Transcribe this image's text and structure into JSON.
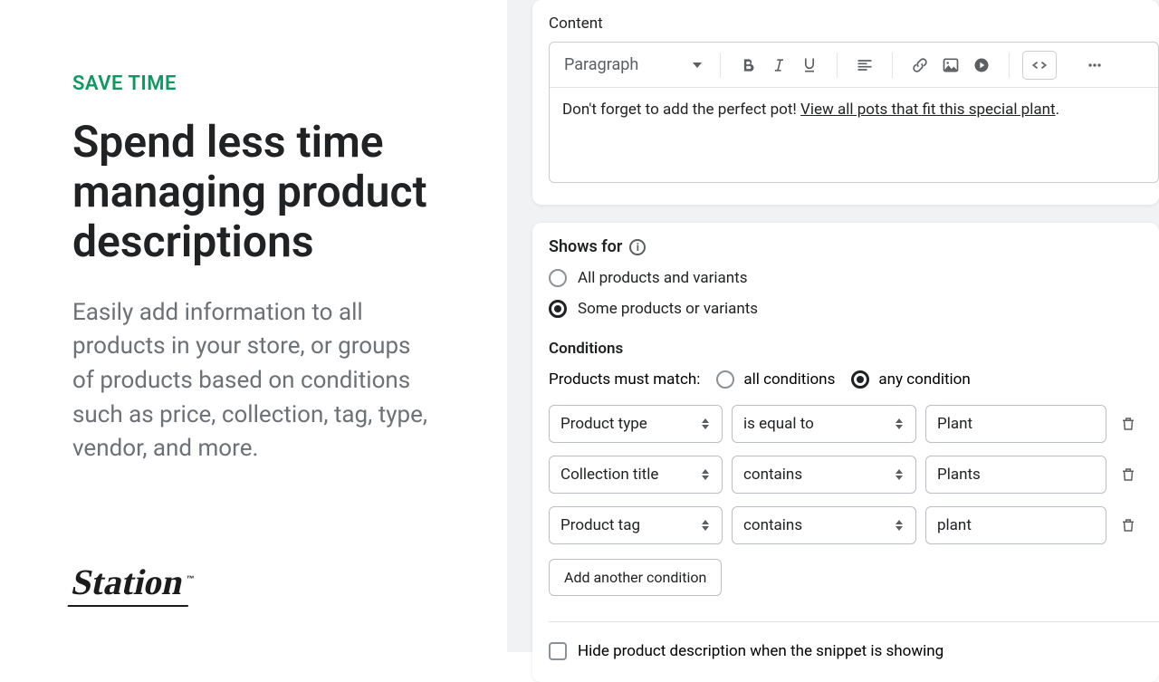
{
  "left": {
    "eyebrow": "SAVE TIME",
    "headline": "Spend less time managing product descriptions",
    "subhead": "Easily add information to all products in your store, or groups of products based on conditions such as price, collection, tag, type, vendor, and more.",
    "logo": "Station"
  },
  "editor": {
    "label": "Content",
    "paragraph_label": "Paragraph",
    "body_text_pre": "Don't forget to add the perfect pot! ",
    "body_link": "View all pots that fit this special plant",
    "body_text_post": "."
  },
  "shows_for": {
    "title": "Shows for",
    "option_all": "All products and variants",
    "option_some": "Some products or variants",
    "selected": "some"
  },
  "conditions": {
    "header": "Conditions",
    "match_label": "Products must match:",
    "match_all": "all conditions",
    "match_any": "any condition",
    "match_selected": "any",
    "rows": [
      {
        "field": "Product type",
        "op": "is equal to",
        "value": "Plant"
      },
      {
        "field": "Collection title",
        "op": "contains",
        "value": "Plants"
      },
      {
        "field": "Product tag",
        "op": "contains",
        "value": "plant"
      }
    ],
    "add_label": "Add another condition",
    "hide_label": "Hide product description when the snippet is showing"
  }
}
